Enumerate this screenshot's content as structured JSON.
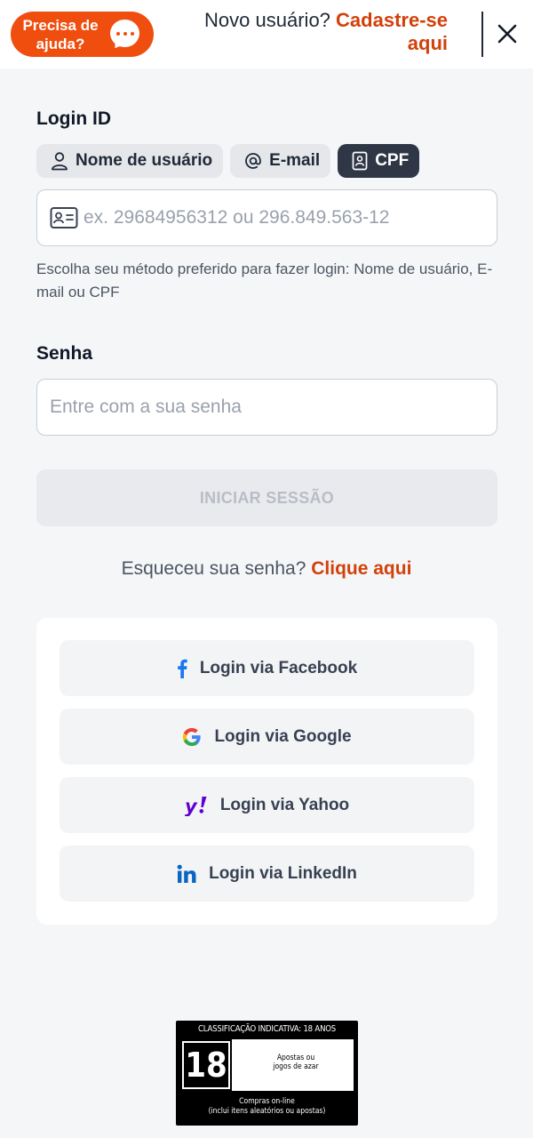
{
  "header": {
    "help_label": "Precisa de ajuda?",
    "signup_prefix": "Novo usuário?",
    "signup_link": "Cadastre-se aqui"
  },
  "login_id": {
    "label": "Login ID",
    "tabs": [
      {
        "label": "Nome de usuário",
        "icon": "user-icon",
        "active": false
      },
      {
        "label": "E-mail",
        "icon": "at-icon",
        "active": false
      },
      {
        "label": "CPF",
        "icon": "id-badge-icon",
        "active": true
      }
    ],
    "input_value": "",
    "input_placeholder": "ex. 29684956312 ou 296.849.563-12",
    "hint": "Escolha seu método preferido para fazer login: Nome de usuário, E-mail ou CPF"
  },
  "password": {
    "label": "Senha",
    "input_value": "",
    "placeholder": "Entre com a sua senha"
  },
  "submit_label": "INICIAR SESSÃO",
  "forgot": {
    "prefix": "Esqueceu sua senha?",
    "link": "Clique aqui"
  },
  "social": [
    {
      "label": "Login via Facebook",
      "icon": "facebook-icon"
    },
    {
      "label": "Login via Google",
      "icon": "google-icon"
    },
    {
      "label": "Login via Yahoo",
      "icon": "yahoo-icon"
    },
    {
      "label": "Login via LinkedIn",
      "icon": "linkedin-icon"
    }
  ],
  "rating": {
    "title": "CLASSIFICAÇÃO INDICATIVA: 18 ANOS",
    "age": "18",
    "desc_line1": "Apostas ou",
    "desc_line2": "jogos de azar",
    "foot_line1": "Compras on-line",
    "foot_line2": "(inclui itens aleatórios ou apostas)"
  },
  "colors": {
    "accent": "#f04e0f",
    "link": "#d2410b",
    "active_tab": "#2f3747",
    "background": "#f5f6f8"
  }
}
